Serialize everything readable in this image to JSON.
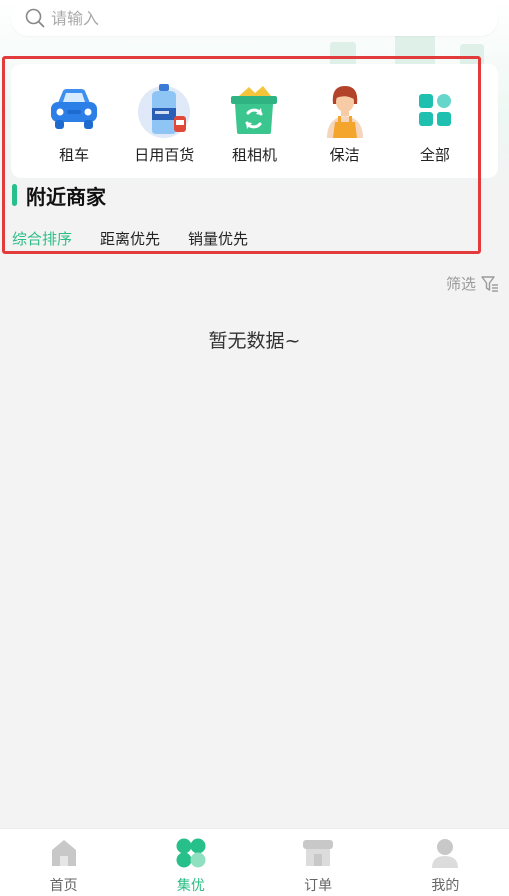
{
  "search": {
    "placeholder": "请输入"
  },
  "categories": [
    {
      "label": "租车",
      "icon": "car-icon"
    },
    {
      "label": "日用百货",
      "icon": "water-bottle-icon"
    },
    {
      "label": "租相机",
      "icon": "camera-box-icon"
    },
    {
      "label": "保洁",
      "icon": "cleaner-icon"
    },
    {
      "label": "全部",
      "icon": "grid-icon"
    }
  ],
  "section": {
    "title": "附近商家"
  },
  "sorts": [
    "综合排序",
    "距离优先",
    "销量优先"
  ],
  "filter": {
    "label": "筛选"
  },
  "empty": {
    "text": "暂无数据~"
  },
  "tabbar": [
    {
      "label": "首页",
      "icon": "home-icon",
      "active": false
    },
    {
      "label": "集优",
      "icon": "clover-icon",
      "active": true
    },
    {
      "label": "订单",
      "icon": "shop-icon",
      "active": false
    },
    {
      "label": "我的",
      "icon": "user-icon",
      "active": false
    }
  ],
  "colors": {
    "accent": "#2bbd86",
    "highlight": "#e23b3b"
  }
}
